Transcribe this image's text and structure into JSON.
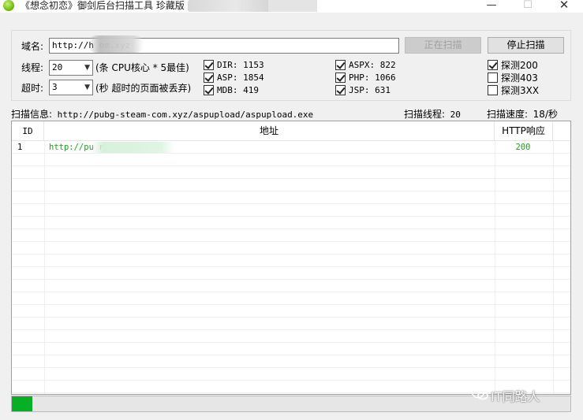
{
  "window": {
    "title": "《想念初恋》御剑后台扫描工具 珍藏版",
    "minimize": "—",
    "maximize": "☐",
    "close": "✕"
  },
  "config": {
    "domain_label": "域名:",
    "domain_value": "http://h              om.xyz",
    "threads_label": "线程:",
    "threads_value": "20",
    "threads_hint": "(条 CPU核心 * 5最佳)",
    "timeout_label": "超时:",
    "timeout_value": "3",
    "timeout_hint": "(秒 超时的页面被丢弃)",
    "scan_button": "正在扫描",
    "stop_button": "停止扫描"
  },
  "dictionaries": [
    {
      "label": "DIR: 1153",
      "checked": true
    },
    {
      "label": "ASP: 1854",
      "checked": true
    },
    {
      "label": "MDB: 419",
      "checked": true
    },
    {
      "label": "ASPX: 822",
      "checked": true
    },
    {
      "label": "PHP: 1066",
      "checked": true
    },
    {
      "label": "JSP: 631",
      "checked": true
    }
  ],
  "probes": [
    {
      "label": "探测200",
      "checked": true
    },
    {
      "label": "探测403",
      "checked": false
    },
    {
      "label": "探测3XX",
      "checked": false
    }
  ],
  "status": {
    "info_label": "扫描信息:",
    "info_value": "http://pubg-steam-com.xyz/aspupload/aspupload.exe",
    "threads_label": "扫描线程:",
    "threads_value": "20",
    "speed_label": "扫描速度:",
    "speed_value": "18/秒"
  },
  "table": {
    "headers": {
      "id": "ID",
      "url": "地址",
      "code": "HTTP响应"
    },
    "rows": [
      {
        "id": "1",
        "url": "http://pu                    robots.txt",
        "code": "200"
      }
    ]
  },
  "progress": {
    "fraction": 0.02
  },
  "watermark": "IT同路人",
  "colors": {
    "found": "#1aa51a",
    "progress": "#06b025"
  }
}
